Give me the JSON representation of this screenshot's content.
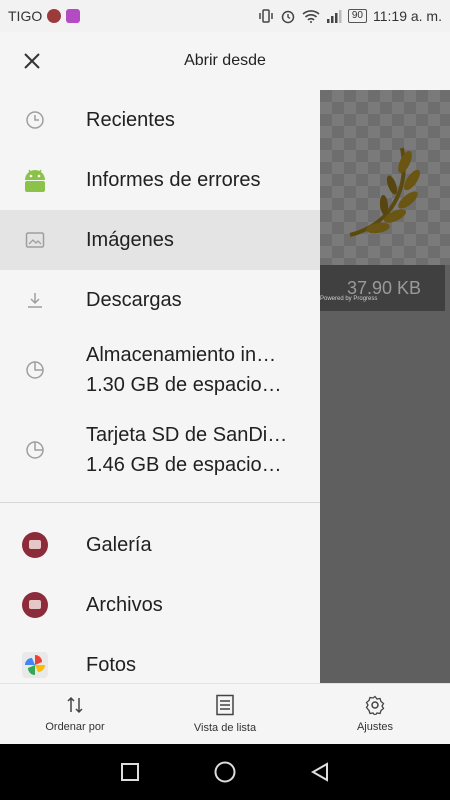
{
  "status_bar": {
    "carrier": "TIGO",
    "battery": "90",
    "time": "11:19 a. m."
  },
  "header": {
    "title": "Abrir desde",
    "close_icon": "close-icon"
  },
  "drawer": {
    "items": [
      {
        "label": "Recientes",
        "icon": "clock-icon"
      },
      {
        "label": "Informes de errores",
        "icon": "android-icon"
      },
      {
        "label": "Imágenes",
        "icon": "image-icon",
        "selected": true
      },
      {
        "label": "Descargas",
        "icon": "download-icon"
      },
      {
        "label": "Almacenamiento in…",
        "sublabel": "1.30 GB de espacio…",
        "icon": "storage-icon"
      },
      {
        "label": "Tarjeta SD de SanDi…",
        "sublabel": "1.46 GB de espacio…",
        "icon": "sd-card-icon"
      },
      {
        "label": "Galería",
        "icon": "gallery-app-icon"
      },
      {
        "label": "Archivos",
        "icon": "files-app-icon"
      },
      {
        "label": "Fotos",
        "icon": "photos-app-icon"
      }
    ]
  },
  "preview": {
    "size": "37.90 KB",
    "powered": "Powered by Progress"
  },
  "toolbar": {
    "sort_label": "Ordenar por",
    "list_view_label": "Vista de lista",
    "settings_label": "Ajustes"
  },
  "colors": {
    "drawer_bg": "#f5f5f5",
    "selected_bg": "#e4e4e4",
    "preview_bg": "#5f5f5f",
    "android_green": "#8bc34a"
  }
}
